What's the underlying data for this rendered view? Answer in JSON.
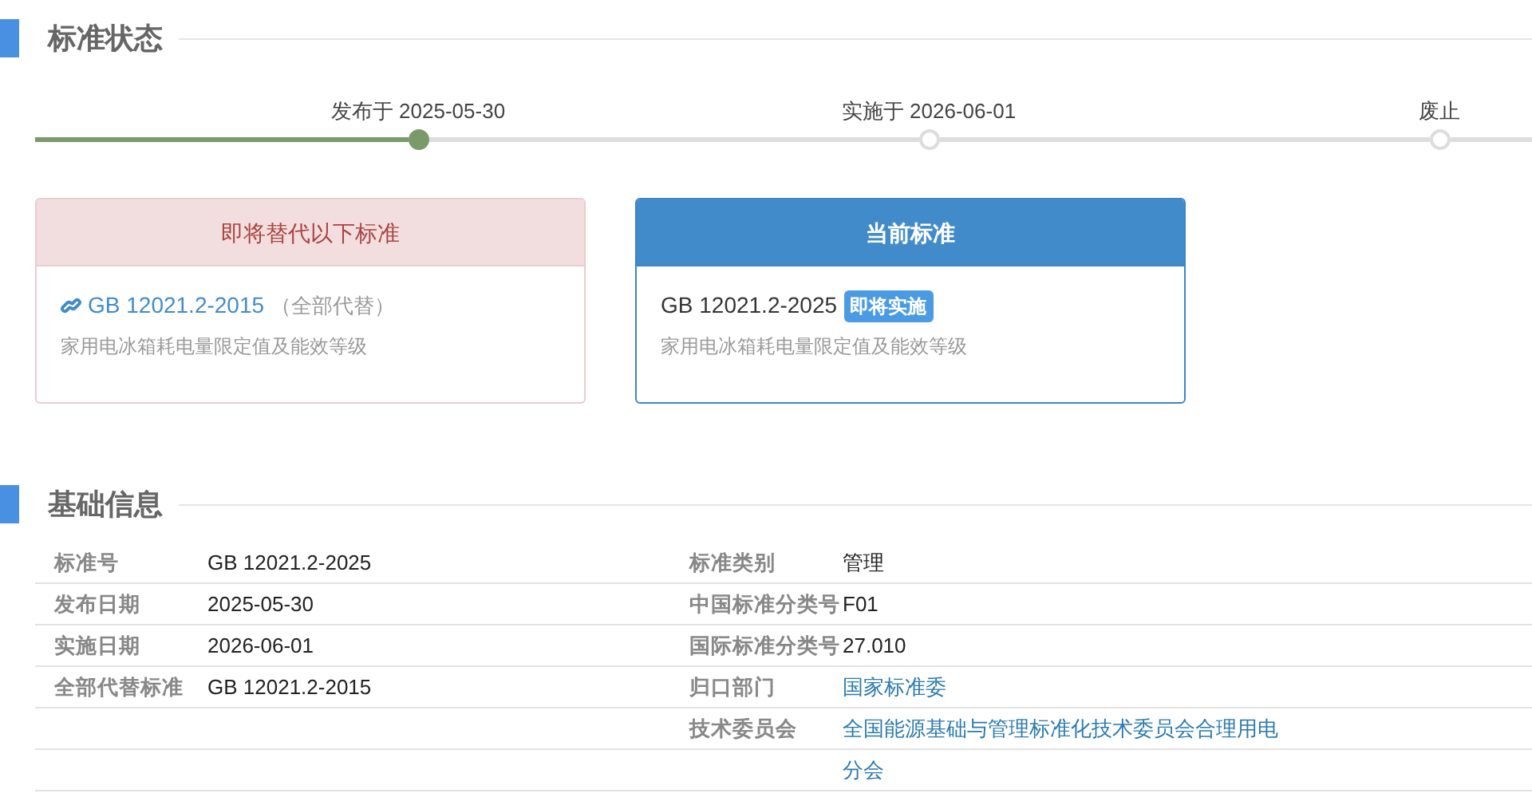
{
  "status_section": {
    "title": "标准状态",
    "timeline": [
      {
        "label": "发布于 2025-05-30",
        "reached": true
      },
      {
        "label": "实施于 2026-06-01",
        "reached": false
      },
      {
        "label": "废止",
        "reached": false
      }
    ],
    "cards": [
      {
        "kind": "replaced",
        "header": "即将替代以下标准",
        "code": "GB 12021.2-2015",
        "note": "（全部代替）",
        "description": "家用电冰箱耗电量限定值及能效等级"
      },
      {
        "kind": "current",
        "header": "当前标准",
        "code": "GB 12021.2-2025",
        "badge": "即将实施",
        "description": "家用电冰箱耗电量限定值及能效等级"
      }
    ]
  },
  "info_section": {
    "title": "基础信息",
    "left": [
      {
        "label": "标准号",
        "value": "GB 12021.2-2025",
        "link": false
      },
      {
        "label": "发布日期",
        "value": "2025-05-30",
        "link": false
      },
      {
        "label": "实施日期",
        "value": "2026-06-01",
        "link": false
      },
      {
        "label": "全部代替标准",
        "value": "GB 12021.2-2015",
        "link": false
      }
    ],
    "right": [
      {
        "label": "标准类别",
        "value": "管理",
        "link": false
      },
      {
        "label": "中国标准分类号",
        "value": "F01",
        "link": false
      },
      {
        "label": "国际标准分类号",
        "value": "27.010",
        "link": false
      },
      {
        "label": "归口部门",
        "value": "国家标准委",
        "link": true
      },
      {
        "label": "技术委员会",
        "value": "全国能源基础与管理标准化技术委员会合理用电分会",
        "link": true
      }
    ]
  }
}
